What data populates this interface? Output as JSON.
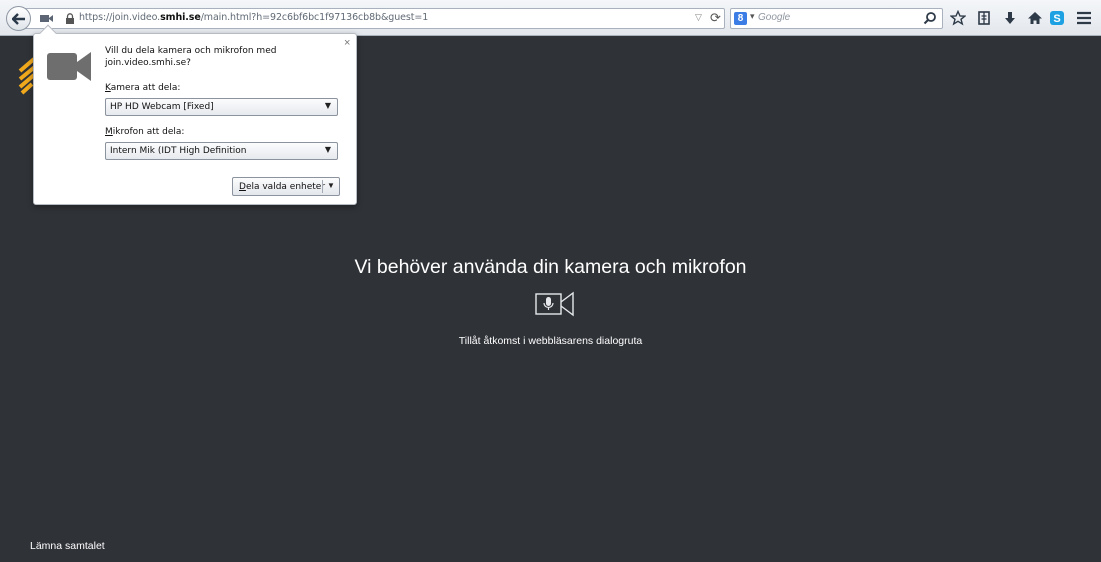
{
  "browser": {
    "url_prefix": "https://join.video.",
    "url_domain": "smhi.se",
    "url_suffix": "/main.html?h=92c6bf6bc1f97136cb8b&guest=1",
    "search_placeholder": "Google",
    "search_engine_letter": "8"
  },
  "popup": {
    "question": "Vill du dela kamera och mikrofon med join.video.smhi.se?",
    "camera_label_accesskey": "K",
    "camera_label_rest": "amera att dela:",
    "camera_value": "HP HD Webcam [Fixed]",
    "mic_label_accesskey": "M",
    "mic_label_rest": "ikrofon att dela:",
    "mic_value": "Intern Mik (IDT High Definition",
    "share_accesskey": "D",
    "share_rest": "ela valda enheter",
    "close": "×"
  },
  "page": {
    "heading": "Vi behöver använda din kamera och mikrofon",
    "subtext": "Tillåt åtkomst i webbläsarens dialogruta",
    "leave_call": "Lämna samtalet"
  },
  "colors": {
    "page_bg": "#2f3237",
    "logo_accent": "#f0a81c"
  }
}
